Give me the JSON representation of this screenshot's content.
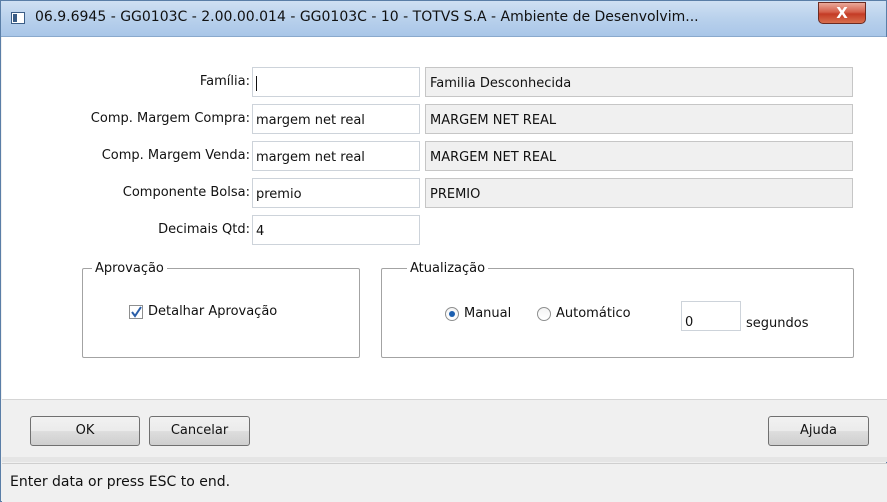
{
  "window": {
    "title": "06.9.6945 - GG0103C - 2.00.00.014 - GG0103C - 10 - TOTVS S.A - Ambiente de Desenvolvim...",
    "close_label": "X"
  },
  "form": {
    "familia": {
      "label": "Família:",
      "value": "",
      "description": "Familia Desconhecida"
    },
    "margem_compra": {
      "label": "Comp. Margem Compra:",
      "value": "margem net real",
      "description": "MARGEM NET REAL"
    },
    "margem_venda": {
      "label": "Comp. Margem Venda:",
      "value": "margem net real",
      "description": "MARGEM NET REAL"
    },
    "bolsa": {
      "label": "Componente Bolsa:",
      "value": "premio",
      "description": "PREMIO"
    },
    "decimais": {
      "label": "Decimais Qtd:",
      "value": "4"
    }
  },
  "aprovacao": {
    "legend": "Aprovação",
    "detalhar_label": "Detalhar Aprovação",
    "detalhar_checked": true
  },
  "atualizacao": {
    "legend": "Atualização",
    "options": [
      "Manual",
      "Automático"
    ],
    "selected": "Manual",
    "seconds_value": "0",
    "seconds_unit": "segundos"
  },
  "buttons": {
    "ok": "OK",
    "cancel": "Cancelar",
    "help": "Ajuda"
  },
  "status": {
    "text": "Enter data or press ESC to end."
  },
  "colors": {
    "accent": "#1c5fb0",
    "titlebar": "#b9d1ec",
    "close": "#c43b25"
  }
}
